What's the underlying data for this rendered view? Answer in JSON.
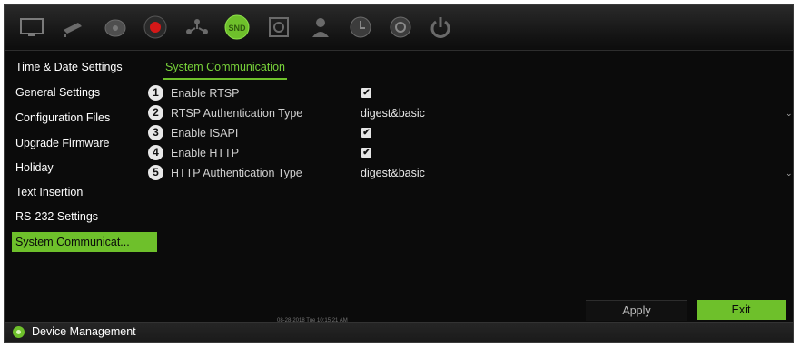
{
  "toolbar": {
    "icons": [
      "monitor-icon",
      "camera-icon",
      "ptz-icon",
      "record-icon",
      "network-icon",
      "device-management-icon",
      "storage-icon",
      "user-icon",
      "alarm-icon",
      "system-icon",
      "power-icon"
    ],
    "device_badge": "SND",
    "active_color": "#6ec02b",
    "record_color": "#d41818"
  },
  "menu": {
    "items": [
      {
        "label": "Time & Date Settings"
      },
      {
        "label": "General Settings"
      },
      {
        "label": "Configuration Files"
      },
      {
        "label": "Upgrade Firmware"
      },
      {
        "label": "Holiday"
      },
      {
        "label": "Text Insertion"
      },
      {
        "label": "RS-232 Settings"
      },
      {
        "label": "System Communicat..."
      }
    ],
    "active_index": 7
  },
  "content": {
    "tab_title": "System Communication",
    "settings": [
      {
        "num": "1",
        "label": "Enable RTSP",
        "checked": true
      },
      {
        "num": "2",
        "label": "RTSP Authentication Type",
        "value": "digest&basic"
      },
      {
        "num": "3",
        "label": "Enable ISAPI",
        "checked": true
      },
      {
        "num": "4",
        "label": "Enable HTTP",
        "checked": true
      },
      {
        "num": "5",
        "label": "HTTP Authentication Type",
        "value": "digest&basic"
      }
    ]
  },
  "buttons": {
    "apply": "Apply",
    "exit": "Exit"
  },
  "timestamp": "08-28-2018 Tue 10:15:21 AM",
  "status": {
    "text": "Device Management"
  },
  "colors": {
    "accent": "#6ec02b",
    "background": "#0b0b0b"
  }
}
